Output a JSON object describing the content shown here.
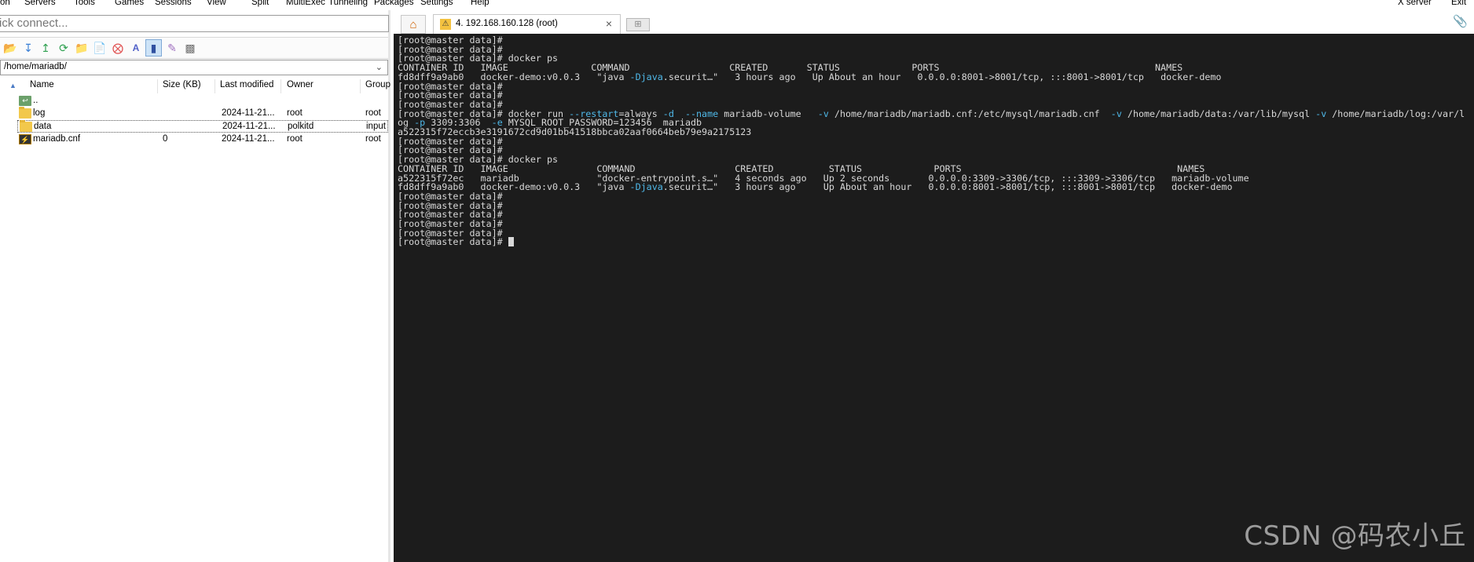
{
  "menu": {
    "items": [
      "on",
      "Servers",
      "Tools",
      "Games",
      "Sessions",
      "View",
      "Split",
      "MultiExec",
      "Tunneling",
      "Packages",
      "Settings",
      "Help"
    ],
    "right_items": [
      "X server",
      "Exit"
    ]
  },
  "sidebar": {
    "quick_connect_text": "ick connect...",
    "path": "/home/mariadb/",
    "columns": [
      "Name",
      "Size (KB)",
      "Last modified",
      "Owner",
      "Group"
    ],
    "files": [
      {
        "name": "..",
        "size": "",
        "modified": "",
        "owner": "",
        "group": "",
        "icon": "parent-folder-icon"
      },
      {
        "name": "log",
        "size": "",
        "modified": "2024-11-21...",
        "owner": "root",
        "group": "root",
        "icon": "folder-icon"
      },
      {
        "name": "data",
        "size": "",
        "modified": "2024-11-21...",
        "owner": "polkitd",
        "group": "input",
        "icon": "folder-icon"
      },
      {
        "name": "mariadb.cnf",
        "size": "0",
        "modified": "2024-11-21...",
        "owner": "root",
        "group": "root",
        "icon": "file-icon"
      }
    ]
  },
  "tabs": {
    "session_label": "4. 192.168.160.128 (root)"
  },
  "terminal": {
    "lines": [
      "[root@master data]#",
      "[root@master data]#",
      "[root@master data]# docker ps",
      "CONTAINER ID   IMAGE               COMMAND                  CREATED       STATUS             PORTS                                       NAMES",
      "fd8dff9a9ab0   docker-demo:v0.0.3   \"java -Djava.securit…\"   3 hours ago   Up About an hour   0.0.0.0:8001->8001/tcp, :::8001->8001/tcp   docker-demo",
      "[root@master data]#",
      "[root@master data]#",
      "[root@master data]#",
      "[root@master data]# docker run --restart=always -d  --name mariadb-volume   -v /home/mariadb/mariadb.cnf:/etc/mysql/mariadb.cnf  -v /home/mariadb/data:/var/lib/mysql -v /home/mariadb/log:/var/l",
      "og -p 3309:3306  -e MYSQL_ROOT_PASSWORD=123456  mariadb",
      "a522315f72eccb3e3191672cd9d01bb41518bbca02aaf0664beb79e9a2175123",
      "[root@master data]#",
      "[root@master data]#",
      "[root@master data]# docker ps",
      "CONTAINER ID   IMAGE                COMMAND                  CREATED          STATUS             PORTS                                       NAMES",
      "a522315f72ec   mariadb              \"docker-entrypoint.s…\"   4 seconds ago   Up 2 seconds       0.0.0.0:3309->3306/tcp, :::3309->3306/tcp   mariadb-volume",
      "fd8dff9a9ab0   docker-demo:v0.0.3   \"java -Djava.securit…\"   3 hours ago     Up About an hour   0.0.0.0:8001->8001/tcp, :::8001->8001/tcp   docker-demo",
      "[root@master data]#",
      "[root@master data]#",
      "[root@master data]#",
      "[root@master data]#",
      "[root@master data]#",
      "[root@master data]# "
    ]
  },
  "watermark": "CSDN @码农小丘",
  "colors": {
    "terminal_bg": "#1c1c1c",
    "terminal_fg": "#d8d8d8",
    "option_highlight": "#4fb8e8"
  }
}
